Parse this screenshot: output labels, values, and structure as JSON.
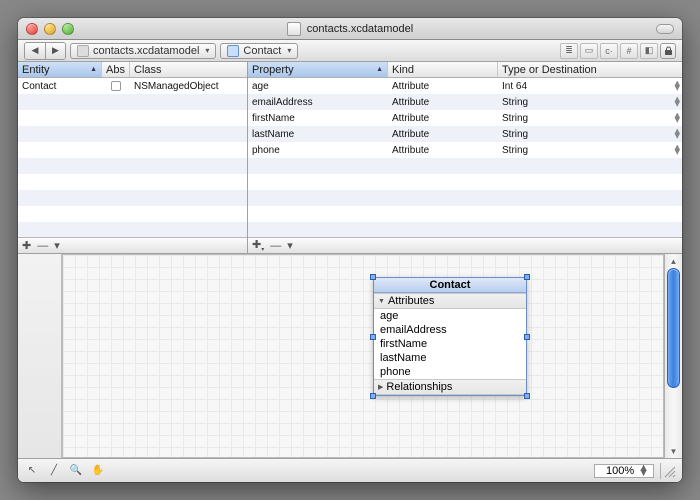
{
  "window": {
    "title": "contacts.xcdatamodel"
  },
  "path": {
    "file": "contacts.xcdatamodel",
    "entity": "Contact"
  },
  "entity_table": {
    "columns": {
      "entity": "Entity",
      "abs": "Abs",
      "class": "Class"
    },
    "rows": [
      {
        "entity": "Contact",
        "abs": false,
        "class": "NSManagedObject"
      }
    ]
  },
  "property_table": {
    "columns": {
      "property": "Property",
      "kind": "Kind",
      "type": "Type or Destination"
    },
    "rows": [
      {
        "property": "age",
        "kind": "Attribute",
        "type": "Int 64"
      },
      {
        "property": "emailAddress",
        "kind": "Attribute",
        "type": "String"
      },
      {
        "property": "firstName",
        "kind": "Attribute",
        "type": "String"
      },
      {
        "property": "lastName",
        "kind": "Attribute",
        "type": "String"
      },
      {
        "property": "phone",
        "kind": "Attribute",
        "type": "String"
      }
    ]
  },
  "diagram": {
    "entity": {
      "name": "Contact",
      "sections": {
        "attributes": "Attributes",
        "relationships": "Relationships"
      },
      "attributes": [
        "age",
        "emailAddress",
        "firstName",
        "lastName",
        "phone"
      ]
    }
  },
  "status": {
    "zoom": "100%"
  }
}
